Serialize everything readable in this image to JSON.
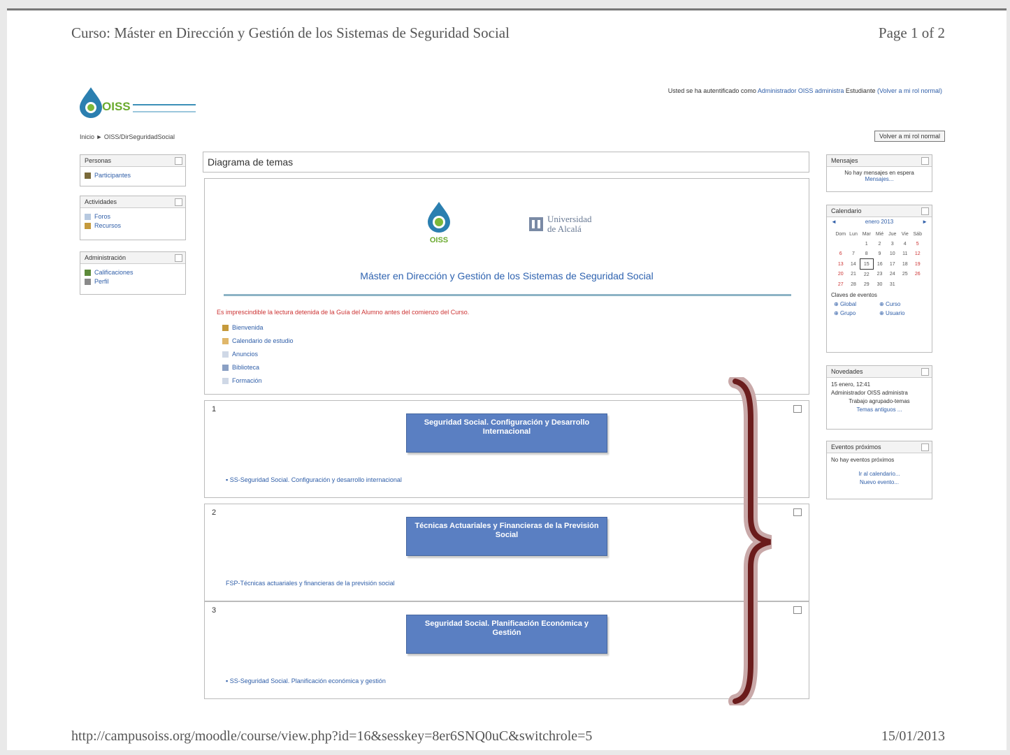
{
  "print": {
    "header": "Curso: Máster en Dirección y Gestión de los Sistemas de Seguridad Social",
    "page": "Page 1 of 2",
    "url": "http://campusoiss.org/moodle/course/view.php?id=16&sesskey=8er6SNQ0uC&switchrole=5",
    "date": "15/01/2013"
  },
  "site": {
    "logo_text": "OISS",
    "login_prefix": "Usted se ha autentificado como",
    "login_user": "Administrador OISS administra",
    "login_role": "Estudiante",
    "login_link": "(Volver a mi rol normal)",
    "breadcrumb": "Inicio ► OISS/DirSeguridadSocial",
    "switch_button": "Volver a mi rol normal"
  },
  "left_blocks": [
    {
      "title": "Personas",
      "items": [
        "Participantes"
      ]
    },
    {
      "title": "Actividades",
      "items": [
        "Foros",
        "Recursos"
      ]
    },
    {
      "title": "Administración",
      "items": [
        "Calificaciones",
        "Perfil"
      ]
    }
  ],
  "main": {
    "title": "Diagrama de temas",
    "uah_logo": [
      "Universidad",
      "de Alcalá"
    ],
    "course_title": "Máster en Dirección y Gestión de los Sistemas de Seguridad Social",
    "notice": "Es imprescindible la lectura detenida de la Guía del Alumno antes del comienzo del Curso.",
    "section0_items": [
      "Bienvenida",
      "Calendario de estudio",
      "Anuncios",
      "Biblioteca",
      "Formación"
    ],
    "sections": [
      {
        "num": "1",
        "banner": "Seguridad Social. Configuración y Desarrollo Internacional",
        "link": "SS-Seguridad Social. Configuración y desarrollo internacional"
      },
      {
        "num": "2",
        "banner": "Técnicas Actuariales y Financieras de la Previsión Social",
        "link": "FSP-Técnicas actuariales y financieras de la previsión social"
      },
      {
        "num": "3",
        "banner": "Seguridad Social. Planificación Económica y Gestión",
        "link": "SS-Seguridad Social. Planificación económica y gestión"
      }
    ]
  },
  "right_blocks": {
    "mensajes": {
      "title": "Mensajes",
      "text": "No hay mensajes en espera",
      "link": "Mensajes..."
    },
    "calendar": {
      "title": "Calendario",
      "month": "enero 2013",
      "days": [
        "Dom",
        "Lun",
        "Mar",
        "Mié",
        "Jue",
        "Vie",
        "Sáb"
      ],
      "weeks": [
        [
          "",
          "",
          "1",
          "2",
          "3",
          "4",
          "5"
        ],
        [
          "6",
          "7",
          "8",
          "9",
          "10",
          "11",
          "12"
        ],
        [
          "13",
          "14",
          "15",
          "16",
          "17",
          "18",
          "19"
        ],
        [
          "20",
          "21",
          "22",
          "23",
          "24",
          "25",
          "26"
        ],
        [
          "27",
          "28",
          "29",
          "30",
          "31",
          "",
          ""
        ]
      ],
      "today": "15",
      "legend_title": "Claves de eventos",
      "legend": [
        "Global",
        "Curso",
        "Grupo",
        "Usuario"
      ]
    },
    "novedades": {
      "title": "Novedades",
      "date": "15 enero, 12:41",
      "author": "Administrador OISS administra",
      "text": "Trabajo agrupado-temas",
      "link": "Temas antiguos ..."
    },
    "eventos": {
      "title": "Eventos próximos",
      "text": "No hay eventos próximos",
      "links": [
        "Ir al calendario...",
        "Nuevo evento..."
      ]
    }
  },
  "colors": {
    "banner": "#5a7fc2",
    "link": "#2f5ea8",
    "notice": "#cc3333",
    "brace": "#6b1c1c"
  }
}
